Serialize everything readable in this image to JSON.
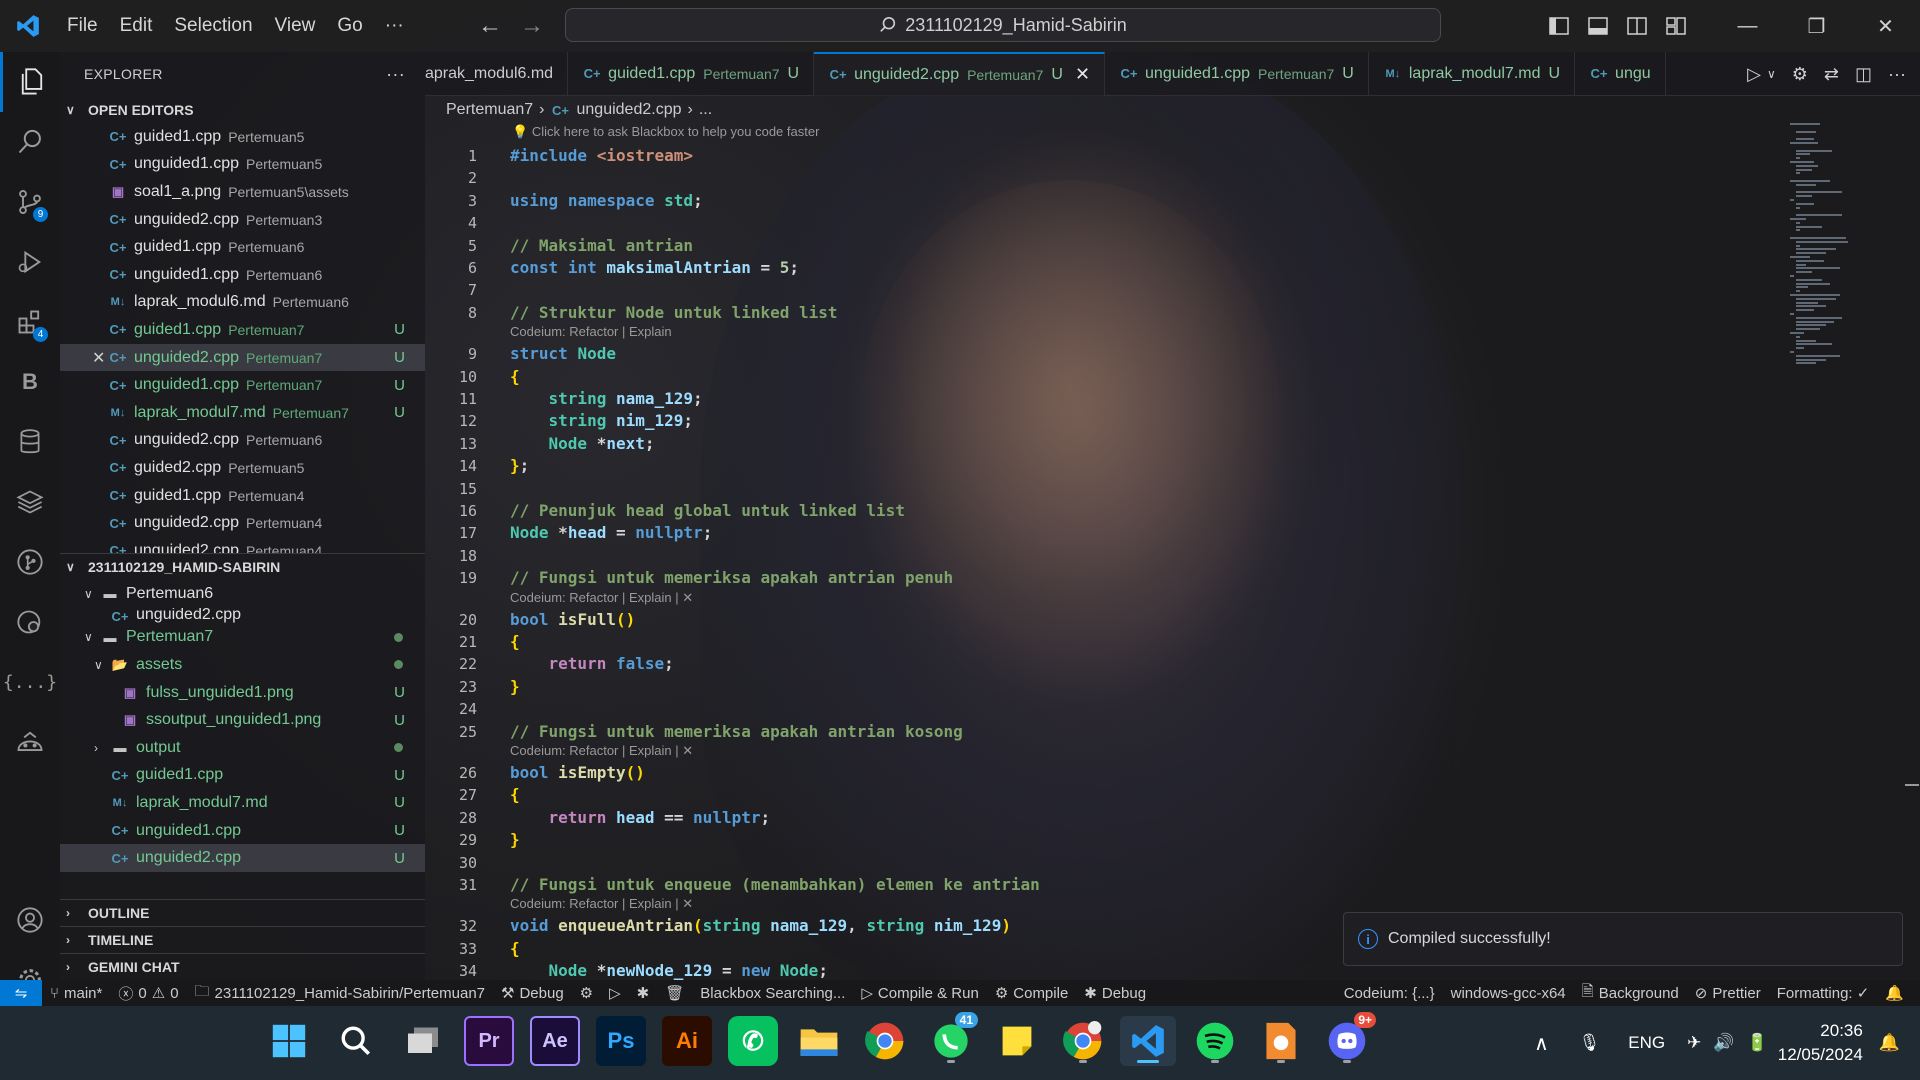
{
  "titlebar": {
    "menu": [
      "File",
      "Edit",
      "Selection",
      "View",
      "Go",
      "···"
    ],
    "search": "2311102129_Hamid-Sabirin"
  },
  "activity_badges": {
    "source_control": "9",
    "extensions": "4"
  },
  "sidebar": {
    "title": "EXPLORER",
    "open_editors_label": "OPEN EDITORS",
    "open_editors": [
      {
        "name": "guided1.cpp",
        "dir": "Pertemuan5",
        "type": "cpp",
        "status": ""
      },
      {
        "name": "unguided1.cpp",
        "dir": "Pertemuan5",
        "type": "cpp",
        "status": ""
      },
      {
        "name": "soal1_a.png",
        "dir": "Pertemuan5\\assets",
        "type": "png",
        "status": ""
      },
      {
        "name": "unguided2.cpp",
        "dir": "Pertemuan3",
        "type": "cpp",
        "status": ""
      },
      {
        "name": "guided1.cpp",
        "dir": "Pertemuan6",
        "type": "cpp",
        "status": ""
      },
      {
        "name": "unguided1.cpp",
        "dir": "Pertemuan6",
        "type": "cpp",
        "status": ""
      },
      {
        "name": "laprak_modul6.md",
        "dir": "Pertemuan6",
        "type": "md",
        "status": ""
      },
      {
        "name": "guided1.cpp",
        "dir": "Pertemuan7",
        "type": "cpp",
        "status": "U"
      },
      {
        "name": "unguided2.cpp",
        "dir": "Pertemuan7",
        "type": "cpp",
        "status": "U"
      },
      {
        "name": "unguided1.cpp",
        "dir": "Pertemuan7",
        "type": "cpp",
        "status": "U"
      },
      {
        "name": "laprak_modul7.md",
        "dir": "Pertemuan7",
        "type": "md",
        "status": "U"
      },
      {
        "name": "unguided2.cpp",
        "dir": "Pertemuan6",
        "type": "cpp",
        "status": ""
      },
      {
        "name": "guided2.cpp",
        "dir": "Pertemuan5",
        "type": "cpp",
        "status": ""
      },
      {
        "name": "guided1.cpp",
        "dir": "Pertemuan4",
        "type": "cpp",
        "status": ""
      },
      {
        "name": "unguided2.cpp",
        "dir": "Pertemuan4",
        "type": "cpp",
        "status": ""
      },
      {
        "name": "unguided2.cpp",
        "dir": "Pertemuan4",
        "type": "cpp",
        "status": ""
      }
    ],
    "workspace_label": "2311102129_HAMID-SABIRIN",
    "tree": [
      {
        "name": "Pertemuan6",
        "kind": "folder",
        "depth": 1,
        "status": ""
      },
      {
        "name": "unguided2.cpp",
        "kind": "cpp",
        "depth": 2,
        "status": ""
      },
      {
        "name": "Pertemuan7",
        "kind": "folder",
        "depth": 1,
        "status": "dot"
      },
      {
        "name": "assets",
        "kind": "folder-open",
        "depth": 2,
        "status": "dot"
      },
      {
        "name": "fulss_unguided1.png",
        "kind": "png",
        "depth": 3,
        "status": "U"
      },
      {
        "name": "ssoutput_unguided1.png",
        "kind": "png",
        "depth": 3,
        "status": "U"
      },
      {
        "name": "output",
        "kind": "folder",
        "depth": 2,
        "status": "dot"
      },
      {
        "name": "guided1.cpp",
        "kind": "cpp",
        "depth": 2,
        "status": "U"
      },
      {
        "name": "laprak_modul7.md",
        "kind": "md",
        "depth": 2,
        "status": "U"
      },
      {
        "name": "unguided1.cpp",
        "kind": "cpp",
        "depth": 2,
        "status": "U"
      },
      {
        "name": "unguided2.cpp",
        "kind": "cpp",
        "depth": 2,
        "status": "U"
      }
    ],
    "outline_label": "OUTLINE",
    "timeline_label": "TIMELINE",
    "gemini_label": "GEMINI CHAT"
  },
  "tabs": [
    {
      "name": "aprak_modul6.md",
      "dir": "",
      "type": "md",
      "status": ""
    },
    {
      "name": "guided1.cpp",
      "dir": "Pertemuan7",
      "type": "cpp",
      "status": "U"
    },
    {
      "name": "unguided2.cpp",
      "dir": "Pertemuan7",
      "type": "cpp",
      "status": "U"
    },
    {
      "name": "unguided1.cpp",
      "dir": "Pertemuan7",
      "type": "cpp",
      "status": "U"
    },
    {
      "name": "laprak_modul7.md",
      "dir": "",
      "type": "md",
      "status": "U"
    },
    {
      "name": "ungu",
      "dir": "",
      "type": "cpp",
      "status": ""
    }
  ],
  "breadcrumb": {
    "folder": "Pertemuan7",
    "file": "unguided2.cpp",
    "more": "..."
  },
  "blackbox_hint": "Click here to ask Blackbox to help you code faster",
  "codelens": {
    "refactor_explain": "Codeium: Refactor | Explain",
    "refactor_explain_x": "Codeium: Refactor | Explain | ✕"
  },
  "code_lines": [
    "#include <iostream>",
    "",
    "using namespace std;",
    "",
    "// Maksimal antrian",
    "const int maksimalAntrian = 5;",
    "",
    "// Struktur Node untuk linked list",
    "struct Node",
    "{",
    "    string nama_129;",
    "    string nim_129;",
    "    Node *next;",
    "};",
    "",
    "// Penunjuk head global untuk linked list",
    "Node *head = nullptr;",
    "",
    "// Fungsi untuk memeriksa apakah antrian penuh",
    "bool isFull()",
    "{",
    "    return false;",
    "}",
    "",
    "// Fungsi untuk memeriksa apakah antrian kosong",
    "bool isEmpty()",
    "{",
    "    return head == nullptr;",
    "}",
    "",
    "// Fungsi untuk enqueue (menambahkan) elemen ke antrian",
    "void enqueueAntrian(string nama_129, string nim_129)",
    "{",
    "    Node *newNode_129 = new Node;"
  ],
  "toast": "Compiled successfully!",
  "statusbar": {
    "branch": "main*",
    "errors": "0",
    "warnings": "0",
    "folder": "2311102129_Hamid-Sabirin/Pertemuan7",
    "debug": "Debug",
    "blackbox": "Blackbox Searching...",
    "compile_run": "Compile & Run",
    "compile": "Compile",
    "debug2": "Debug",
    "codeium": "Codeium: {...}",
    "config": "windows-gcc-x64",
    "background": "Background",
    "prettier": "Prettier",
    "formatting": "Formatting: ✓"
  },
  "taskbar": {
    "whatsapp_badge": "41",
    "discord_badge": "9+",
    "language": "ENG",
    "time": "20:36",
    "date": "12/05/2024"
  },
  "colors": {
    "accent": "#0078d4",
    "untracked": "#73c991",
    "cpp_icon": "#519aba"
  }
}
